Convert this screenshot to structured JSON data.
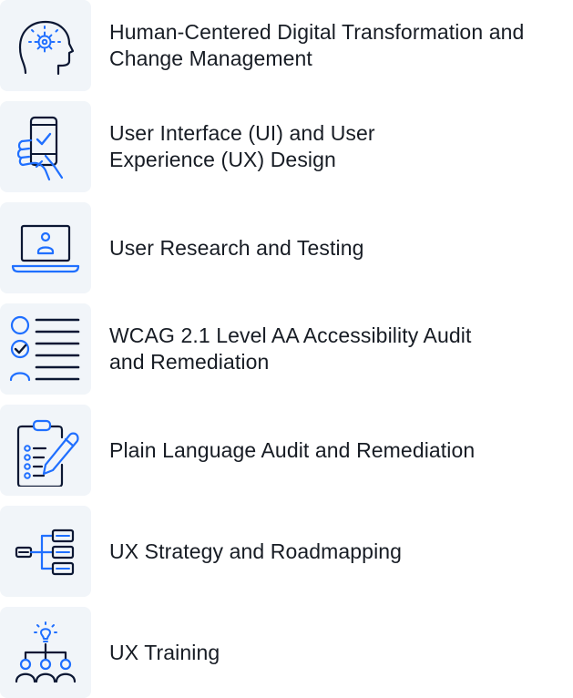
{
  "services": [
    {
      "icon": "human-head-gear-icon",
      "label_lines": [
        "Human-Centered Digital Transformation and",
        "Change Management"
      ]
    },
    {
      "icon": "hand-phone-check-icon",
      "label_lines": [
        "User Interface (UI) and User",
        "Experience (UX) Design"
      ]
    },
    {
      "icon": "laptop-user-icon",
      "label_lines": [
        "User Research and Testing"
      ]
    },
    {
      "icon": "accessibility-checklist-icon",
      "label_lines": [
        "WCAG 2.1 Level AA Accessibility Audit",
        "and Remediation"
      ]
    },
    {
      "icon": "clipboard-pencil-icon",
      "label_lines": [
        "Plain Language Audit and Remediation"
      ]
    },
    {
      "icon": "flowchart-icon",
      "label_lines": [
        "UX Strategy and Roadmapping"
      ]
    },
    {
      "icon": "training-team-icon",
      "label_lines": [
        "UX Training"
      ]
    }
  ],
  "colors": {
    "navy": "#0b1733",
    "blue": "#1f6fff",
    "tile_background": "#f1f5f9",
    "text": "#171c24"
  }
}
